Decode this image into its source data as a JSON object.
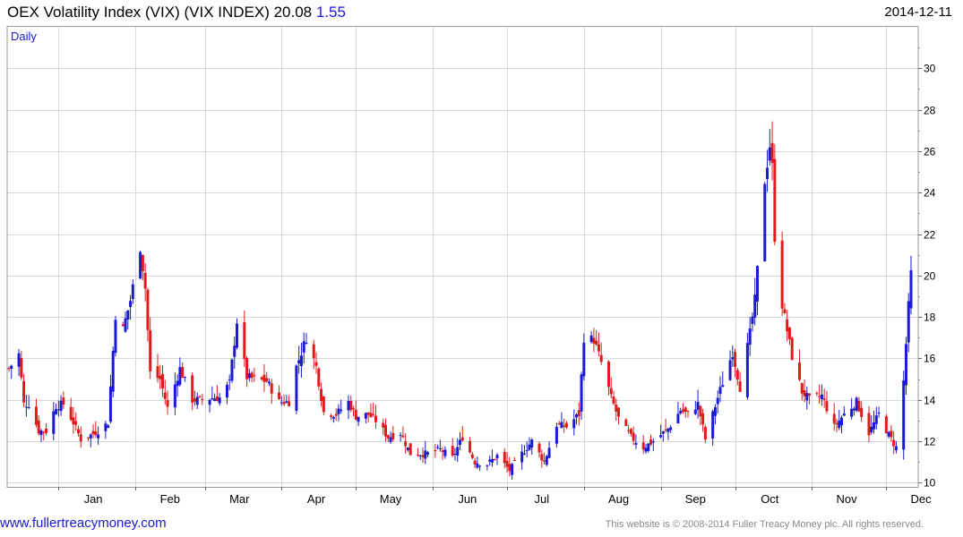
{
  "header": {
    "title": "OEX Volatility Index (VIX) (VIX INDEX) 20.08",
    "change": "1.55",
    "date": "2014-12-11"
  },
  "footer": {
    "site": "www.fullertreacymoney.com",
    "copyright": "This website is © 2008-2014 Fuller Treacy Money plc. All rights reserved."
  },
  "colors": {
    "up": "#1a1ad1",
    "down": "#e01b1b",
    "grid": "#d9d9d9"
  },
  "chart_data": {
    "type": "candlestick",
    "period_label": "Daily",
    "x_range": [
      "2013-12-12",
      "2014-12-11"
    ],
    "ylim": [
      9.8,
      32.0
    ],
    "yticks": [
      10,
      12,
      14,
      16,
      18,
      20,
      22,
      24,
      26,
      28,
      30
    ],
    "y_axis_side": "right",
    "x_tick_labels": [
      {
        "label": "Jan",
        "date": "2014-01-01"
      },
      {
        "label": "Feb",
        "date": "2014-02-01"
      },
      {
        "label": "Mar",
        "date": "2014-03-01"
      },
      {
        "label": "Apr",
        "date": "2014-04-01"
      },
      {
        "label": "May",
        "date": "2014-05-01"
      },
      {
        "label": "Jun",
        "date": "2014-06-01"
      },
      {
        "label": "Jul",
        "date": "2014-07-01"
      },
      {
        "label": "Aug",
        "date": "2014-08-01"
      },
      {
        "label": "Sep",
        "date": "2014-09-01"
      },
      {
        "label": "Oct",
        "date": "2014-10-01"
      },
      {
        "label": "Nov",
        "date": "2014-11-01"
      },
      {
        "label": "Dec",
        "date": "2014-12-01"
      }
    ],
    "grid": true,
    "close_path": [
      [
        "2013-12-12",
        15.5
      ],
      [
        "2013-12-16",
        16.2
      ],
      [
        "2013-12-18",
        13.8
      ],
      [
        "2013-12-20",
        13.8
      ],
      [
        "2013-12-24",
        12.5
      ],
      [
        "2013-12-27",
        12.5
      ],
      [
        "2013-12-31",
        13.7
      ],
      [
        "2014-01-03",
        13.8
      ],
      [
        "2014-01-07",
        12.9
      ],
      [
        "2014-01-10",
        12.1
      ],
      [
        "2014-01-14",
        12.3
      ],
      [
        "2014-01-17",
        12.5
      ],
      [
        "2014-01-21",
        12.9
      ],
      [
        "2014-01-24",
        18.1
      ],
      [
        "2014-01-27",
        17.4
      ],
      [
        "2014-01-30",
        18.8
      ],
      [
        "2014-02-03",
        21.4
      ],
      [
        "2014-02-05",
        19.4
      ],
      [
        "2014-02-07",
        15.3
      ],
      [
        "2014-02-11",
        15.0
      ],
      [
        "2014-02-14",
        13.6
      ],
      [
        "2014-02-19",
        15.5
      ],
      [
        "2014-02-24",
        14.0
      ],
      [
        "2014-02-28",
        14.0
      ],
      [
        "2014-03-04",
        14.1
      ],
      [
        "2014-03-07",
        14.1
      ],
      [
        "2014-03-11",
        14.8
      ],
      [
        "2014-03-14",
        17.8
      ],
      [
        "2014-03-18",
        15.1
      ],
      [
        "2014-03-21",
        15.0
      ],
      [
        "2014-03-26",
        14.9
      ],
      [
        "2014-03-31",
        13.9
      ],
      [
        "2014-04-04",
        13.9
      ],
      [
        "2014-04-07",
        15.6
      ],
      [
        "2014-04-11",
        17.0
      ],
      [
        "2014-04-15",
        15.6
      ],
      [
        "2014-04-18",
        13.4
      ],
      [
        "2014-04-23",
        13.3
      ],
      [
        "2014-04-28",
        13.9
      ],
      [
        "2014-05-01",
        13.2
      ],
      [
        "2014-05-06",
        13.3
      ],
      [
        "2014-05-09",
        13.0
      ],
      [
        "2014-05-14",
        12.2
      ],
      [
        "2014-05-19",
        12.4
      ],
      [
        "2014-05-23",
        11.4
      ],
      [
        "2014-05-30",
        11.4
      ],
      [
        "2014-06-04",
        11.6
      ],
      [
        "2014-06-09",
        11.2
      ],
      [
        "2014-06-13",
        12.2
      ],
      [
        "2014-06-18",
        11.0
      ],
      [
        "2014-06-23",
        10.9
      ],
      [
        "2014-06-27",
        11.3
      ],
      [
        "2014-07-02",
        10.6
      ],
      [
        "2014-07-07",
        11.4
      ],
      [
        "2014-07-11",
        12.0
      ],
      [
        "2014-07-16",
        11.0
      ],
      [
        "2014-07-21",
        12.8
      ],
      [
        "2014-07-25",
        12.7
      ],
      [
        "2014-07-30",
        13.3
      ],
      [
        "2014-08-01",
        17.0
      ],
      [
        "2014-08-05",
        16.9
      ],
      [
        "2014-08-08",
        15.8
      ],
      [
        "2014-08-12",
        14.1
      ],
      [
        "2014-08-15",
        13.1
      ],
      [
        "2014-08-20",
        12.2
      ],
      [
        "2014-08-25",
        11.7
      ],
      [
        "2014-08-29",
        12.0
      ],
      [
        "2014-09-04",
        12.6
      ],
      [
        "2014-09-09",
        13.5
      ],
      [
        "2014-09-12",
        13.3
      ],
      [
        "2014-09-16",
        13.8
      ],
      [
        "2014-09-19",
        12.1
      ],
      [
        "2014-09-24",
        14.1
      ],
      [
        "2014-09-30",
        16.3
      ],
      [
        "2014-10-03",
        14.6
      ],
      [
        "2014-10-07",
        17.2
      ],
      [
        "2014-10-09",
        18.8
      ],
      [
        "2014-10-13",
        24.6
      ],
      [
        "2014-10-15",
        26.3
      ],
      [
        "2014-10-16",
        25.2
      ],
      [
        "2014-10-17",
        21.9
      ],
      [
        "2014-10-20",
        18.6
      ],
      [
        "2014-10-24",
        16.1
      ],
      [
        "2014-10-28",
        14.4
      ],
      [
        "2014-10-31",
        14.0
      ],
      [
        "2014-11-05",
        14.2
      ],
      [
        "2014-11-10",
        12.7
      ],
      [
        "2014-11-14",
        13.3
      ],
      [
        "2014-11-19",
        13.9
      ],
      [
        "2014-11-24",
        12.4
      ],
      [
        "2014-11-28",
        13.3
      ],
      [
        "2014-12-02",
        12.3
      ],
      [
        "2014-12-05",
        11.7
      ],
      [
        "2014-12-08",
        14.9
      ],
      [
        "2014-12-10",
        18.5
      ],
      [
        "2014-12-11",
        20.08
      ]
    ]
  }
}
